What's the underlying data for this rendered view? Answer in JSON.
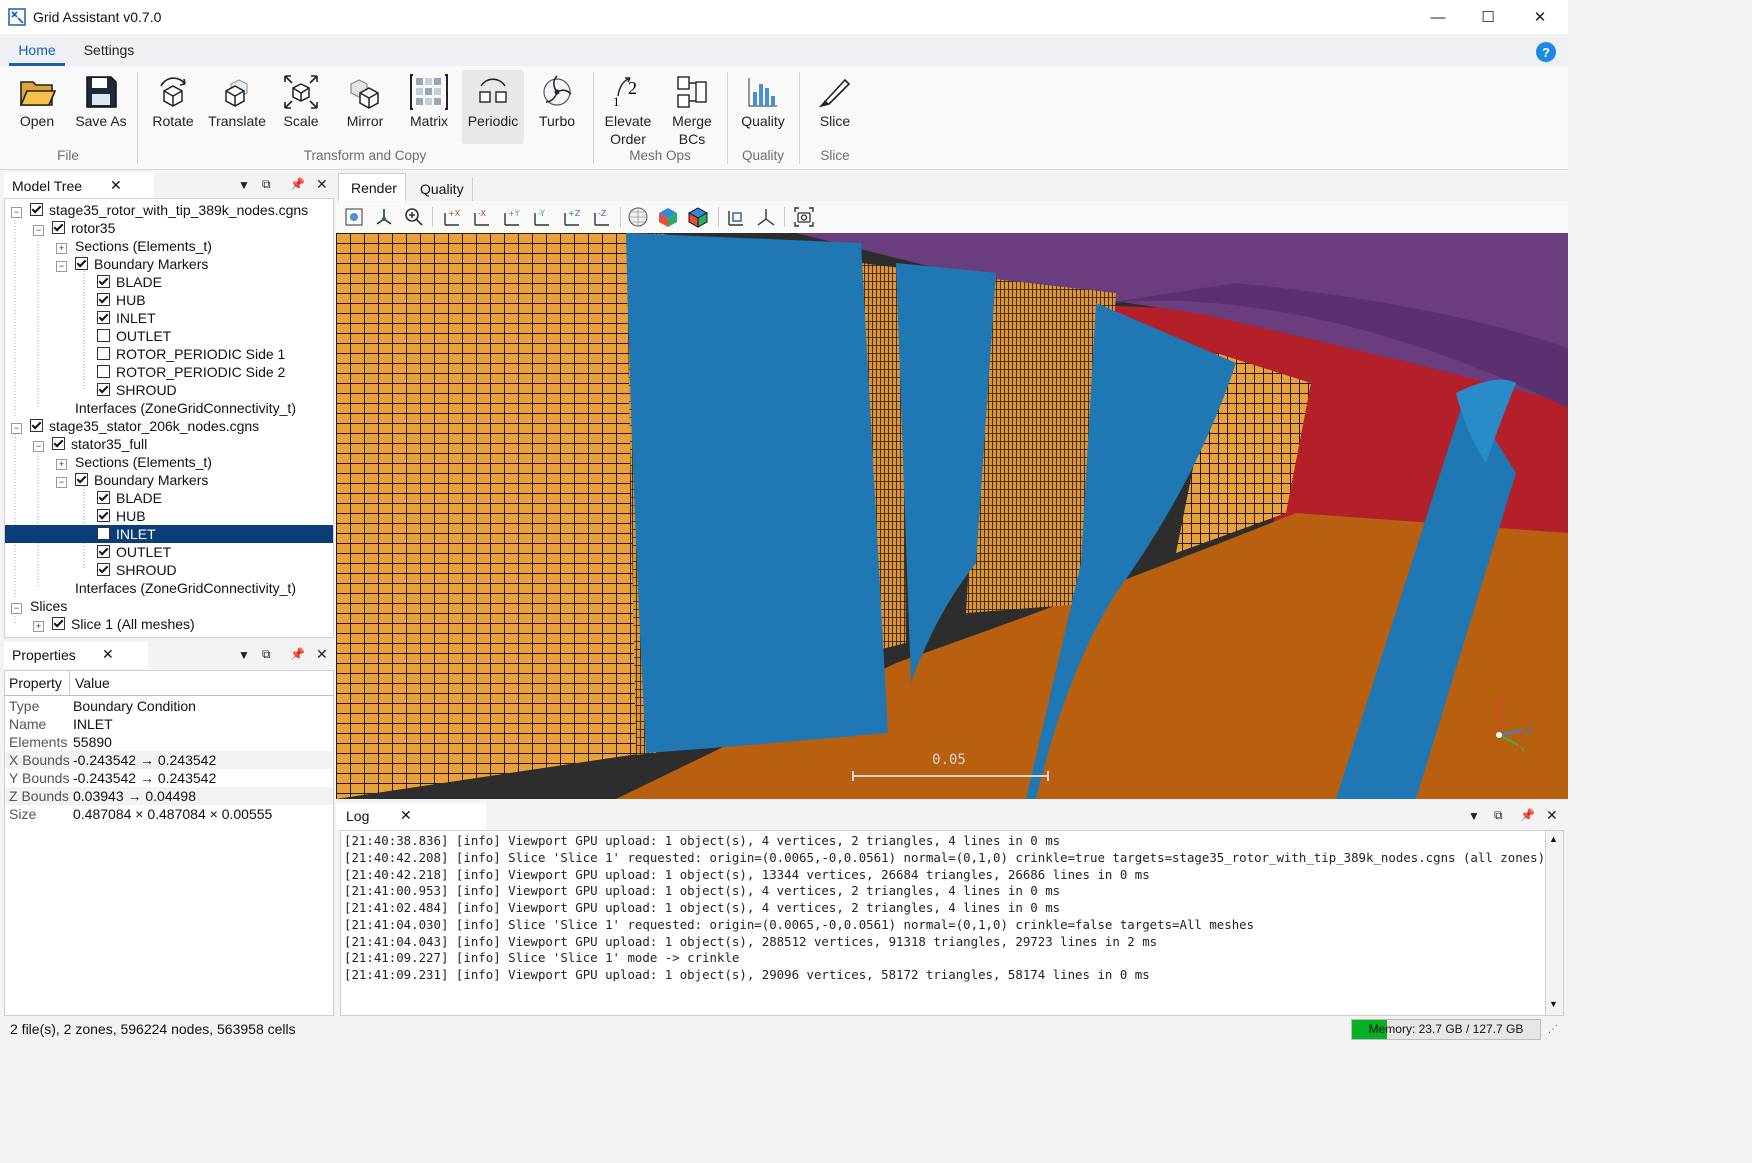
{
  "window": {
    "title": "Grid Assistant  v0.7.0",
    "minimize": "—",
    "maximize": "☐",
    "close": "✕"
  },
  "ribbon_tabs": [
    "Home",
    "Settings"
  ],
  "help": "?",
  "ribbon": {
    "buttons": [
      "Open",
      "Save As",
      "Rotate",
      "Translate",
      "Scale",
      "Mirror",
      "Matrix",
      "Periodic",
      "Turbo",
      "Elevate",
      "Order",
      "Merge",
      "BCs",
      "Quality",
      "Slice"
    ],
    "groups": [
      "File",
      "Transform and Copy",
      "Mesh Ops",
      "Quality",
      "Slice"
    ]
  },
  "model_tree": {
    "title": "Model Tree",
    "rows": [
      "stage35_rotor_with_tip_389k_nodes.cgns",
      "rotor35",
      "Sections (Elements_t)",
      "Boundary Markers",
      "BLADE",
      "HUB",
      "INLET",
      "OUTLET",
      "ROTOR_PERIODIC Side 1",
      "ROTOR_PERIODIC Side 2",
      "SHROUD",
      "Interfaces (ZoneGridConnectivity_t)",
      "stage35_stator_206k_nodes.cgns",
      "stator35_full",
      "Sections (Elements_t)",
      "Boundary Markers",
      "BLADE",
      "HUB",
      "INLET",
      "OUTLET",
      "SHROUD",
      "Interfaces (ZoneGridConnectivity_t)",
      "Slices",
      "Slice 1  (All meshes)"
    ]
  },
  "properties": {
    "title": "Properties",
    "col_property": "Property",
    "col_value": "Value",
    "rows": [
      {
        "k": "Type",
        "v": "Boundary Condition"
      },
      {
        "k": "Name",
        "v": "INLET"
      },
      {
        "k": "Elements",
        "v": "55890"
      },
      {
        "k": "X Bounds",
        "v": "-0.243542 → 0.243542"
      },
      {
        "k": "Y Bounds",
        "v": "-0.243542 → 0.243542"
      },
      {
        "k": "Z Bounds",
        "v": "0.03943 → 0.04498"
      },
      {
        "k": "Size",
        "v": "0.487084 × 0.487084 × 0.00555"
      }
    ]
  },
  "view_tabs": [
    "Render",
    "Quality"
  ],
  "viewport": {
    "scale_label": "0.05",
    "axis_x": "X",
    "axis_y": "Y",
    "axis_z": "Z"
  },
  "log": {
    "title": "Log",
    "lines": [
      "[21:40:38.836] [info] Viewport GPU upload: 1 object(s), 4 vertices, 2 triangles, 4 lines in 0 ms",
      "[21:40:42.208] [info] Slice 'Slice 1' requested: origin=(0.0065,-0,0.0561) normal=(0,1,0) crinkle=true targets=stage35_rotor_with_tip_389k_nodes.cgns (all zones)",
      "[21:40:42.218] [info] Viewport GPU upload: 1 object(s), 13344 vertices, 26684 triangles, 26686 lines in 0 ms",
      "[21:41:00.953] [info] Viewport GPU upload: 1 object(s), 4 vertices, 2 triangles, 4 lines in 0 ms",
      "[21:41:02.484] [info] Viewport GPU upload: 1 object(s), 4 vertices, 2 triangles, 4 lines in 0 ms",
      "[21:41:04.030] [info] Slice 'Slice 1' requested: origin=(0.0065,-0,0.0561) normal=(0,1,0) crinkle=false targets=All meshes",
      "[21:41:04.043] [info] Viewport GPU upload: 1 object(s), 288512 vertices, 91318 triangles, 29723 lines in 2 ms",
      "[21:41:09.227] [info] Slice 'Slice 1' mode -> crinkle",
      "[21:41:09.231] [info] Viewport GPU upload: 1 object(s), 29096 vertices, 58172 triangles, 58174 lines in 0 ms"
    ]
  },
  "status": {
    "text": "2 file(s), 2 zones, 596224 nodes, 563958 cells",
    "memory": "Memory: 23.7 GB / 127.7 GB",
    "memory_fraction": 0.186
  },
  "colors": {
    "accent": "#1a5fb4",
    "selection": "#0b3d78",
    "mesh_orange": "#e9a13c",
    "blade_blue": "#1f78b4",
    "hub_orange": "#b8600f",
    "shroud_purple": "#6a3d7e",
    "red_wall": "#b3202a",
    "memory_green": "#06b025"
  }
}
